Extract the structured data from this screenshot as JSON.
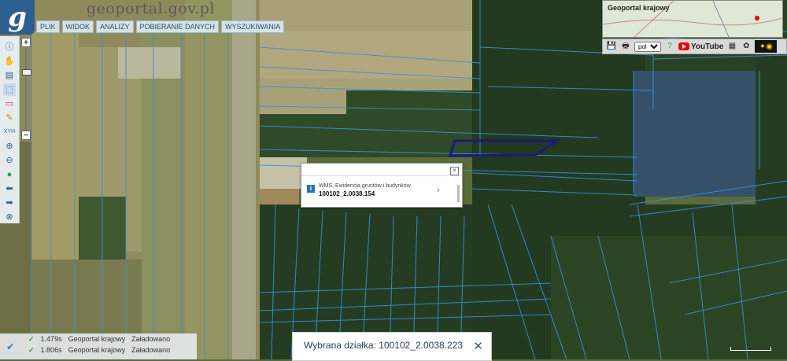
{
  "brand": {
    "name": "geoportal.gov.pl",
    "logo_letter": "g"
  },
  "menu": [
    "PLIK",
    "WIDOK",
    "ANALIZY",
    "POBIERANIE DANYCH",
    "WYSZUKIWANIA"
  ],
  "toolbar": {
    "tools": [
      "info-icon",
      "hand-icon",
      "legend-icon",
      "select-icon",
      "rectangle-icon",
      "pencil-icon",
      "xyh-icon",
      "zoom-in-icon",
      "zoom-out-icon",
      "globe-icon",
      "back-icon",
      "forward-icon",
      "target-icon"
    ],
    "xyh_label": "XYH"
  },
  "zoom": {
    "plus": "+",
    "minus": "−"
  },
  "overview": {
    "title": "Geoportal krajowy"
  },
  "topbar": {
    "language": "pol",
    "youtube": "YouTube"
  },
  "popup": {
    "layer": "WMS, Ewidencja gruntów i budynków",
    "parcel_id": "100102_2.0038.154",
    "close": "×",
    "arrow": "›"
  },
  "selection": {
    "text": "Wybrana działka: 100102_2.0038.223",
    "close": "✕"
  },
  "status": [
    {
      "time": "1.479s",
      "source": "Geoportal krajowy",
      "state": "Załadowano"
    },
    {
      "time": "1.806s",
      "source": "Geoportal krajowy",
      "state": "Załadowano"
    }
  ],
  "colors": {
    "parcel_lines": "#3a8fd8",
    "selected_parcel": "#1a1a7a",
    "accent": "#2c5f8f"
  }
}
